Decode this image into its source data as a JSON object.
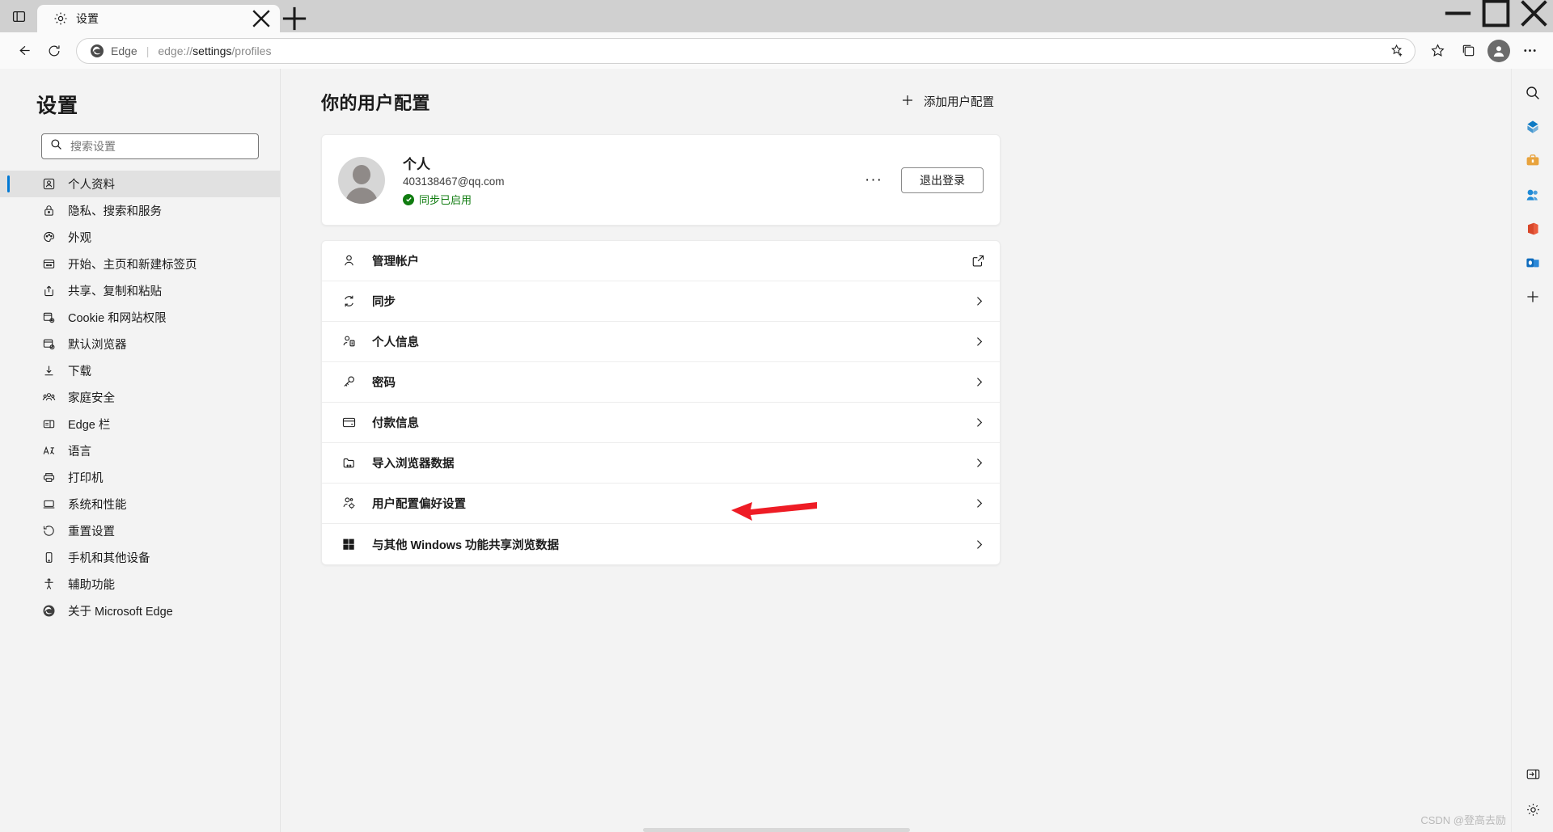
{
  "window": {
    "tab": {
      "title": "设置",
      "favicon": "gear-icon"
    },
    "controls": {
      "minimize": "—",
      "maximize": "▢",
      "close": "✕"
    }
  },
  "omnibox": {
    "brand": "Edge",
    "separator": "|",
    "url_prefix": "edge://",
    "url_bold": "settings",
    "url_suffix": "/profiles",
    "full_url": "edge://settings/profiles"
  },
  "sidebar": {
    "title": "设置",
    "search": {
      "placeholder": "搜索设置",
      "value": ""
    },
    "items": [
      {
        "label": "个人资料",
        "icon": "profile-icon",
        "active": true
      },
      {
        "label": "隐私、搜索和服务",
        "icon": "lock-icon",
        "active": false
      },
      {
        "label": "外观",
        "icon": "palette-icon",
        "active": false
      },
      {
        "label": "开始、主页和新建标签页",
        "icon": "newtab-icon",
        "active": false
      },
      {
        "label": "共享、复制和粘贴",
        "icon": "share-icon",
        "active": false
      },
      {
        "label": "Cookie 和网站权限",
        "icon": "cookie-icon",
        "active": false
      },
      {
        "label": "默认浏览器",
        "icon": "default-browser-icon",
        "active": false
      },
      {
        "label": "下载",
        "icon": "download-icon",
        "active": false
      },
      {
        "label": "家庭安全",
        "icon": "family-icon",
        "active": false
      },
      {
        "label": "Edge 栏",
        "icon": "edgebar-icon",
        "active": false
      },
      {
        "label": "语言",
        "icon": "language-icon",
        "active": false
      },
      {
        "label": "打印机",
        "icon": "printer-icon",
        "active": false
      },
      {
        "label": "系统和性能",
        "icon": "system-icon",
        "active": false
      },
      {
        "label": "重置设置",
        "icon": "reset-icon",
        "active": false
      },
      {
        "label": "手机和其他设备",
        "icon": "phone-icon",
        "active": false
      },
      {
        "label": "辅助功能",
        "icon": "accessibility-icon",
        "active": false
      },
      {
        "label": "关于 Microsoft Edge",
        "icon": "edge-logo-icon",
        "active": false
      }
    ]
  },
  "main": {
    "heading": "你的用户配置",
    "add_profile_label": "添加用户配置",
    "profile": {
      "name": "个人",
      "email": "403138467@qq.com",
      "sync_status": "同步已启用",
      "sync_color": "#107c10",
      "more_label": "···",
      "signout_label": "退出登录"
    },
    "rows": [
      {
        "label": "管理帐户",
        "icon": "person-icon",
        "action": "external-link-icon"
      },
      {
        "label": "同步",
        "icon": "sync-icon",
        "action": "chevron-right-icon"
      },
      {
        "label": "个人信息",
        "icon": "person-card-icon",
        "action": "chevron-right-icon"
      },
      {
        "label": "密码",
        "icon": "key-icon",
        "action": "chevron-right-icon"
      },
      {
        "label": "付款信息",
        "icon": "card-icon",
        "action": "chevron-right-icon"
      },
      {
        "label": "导入浏览器数据",
        "icon": "import-icon",
        "action": "chevron-right-icon",
        "annotated": true
      },
      {
        "label": "用户配置偏好设置",
        "icon": "person-settings-icon",
        "action": "chevron-right-icon"
      },
      {
        "label": "与其他 Windows 功能共享浏览数据",
        "icon": "windows-icon",
        "action": "chevron-right-icon"
      }
    ]
  },
  "rail": {
    "items": [
      {
        "name": "search-icon"
      },
      {
        "name": "shopping-icon"
      },
      {
        "name": "tools-icon"
      },
      {
        "name": "games-icon"
      },
      {
        "name": "office-icon"
      },
      {
        "name": "outlook-icon"
      },
      {
        "name": "add-icon"
      }
    ],
    "bottom": [
      {
        "name": "sidebar-toggle-icon"
      },
      {
        "name": "settings-gear-icon"
      }
    ]
  },
  "annotation": {
    "color": "#ee1c25",
    "target": "导入浏览器数据"
  },
  "watermark": "CSDN @登高去励"
}
